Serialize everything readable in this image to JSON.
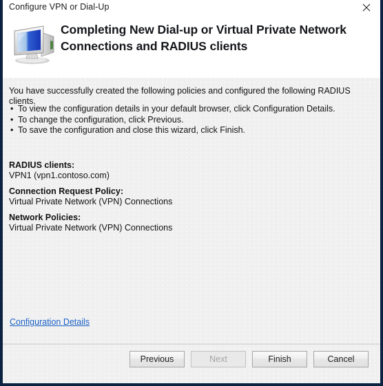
{
  "window": {
    "title": "Configure VPN or Dial-Up",
    "close_icon": "close-icon"
  },
  "header": {
    "icon": "computer-monitor-icon",
    "title": "Completing New Dial-up or Virtual Private Network Connections and RADIUS clients"
  },
  "body": {
    "intro": "You have successfully created the following policies and configured the following RADIUS clients.",
    "bullets": [
      "To view the configuration details in your default browser, click Configuration Details.",
      "To change the configuration, click Previous.",
      "To save the configuration and close this wizard, click Finish."
    ],
    "bullet_glyph": "•",
    "results": [
      {
        "label": "RADIUS clients:",
        "value": "VPN1 (vpn1.contoso.com)"
      },
      {
        "label": "Connection Request Policy:",
        "value": "Virtual Private Network (VPN) Connections"
      },
      {
        "label": "Network Policies:",
        "value": "Virtual Private Network (VPN) Connections"
      }
    ],
    "config_link": "Configuration Details"
  },
  "footer": {
    "buttons": [
      {
        "label": "Previous",
        "disabled": false
      },
      {
        "label": "Next",
        "disabled": true
      },
      {
        "label": "Finish",
        "disabled": false
      },
      {
        "label": "Cancel",
        "disabled": false
      }
    ]
  },
  "colors": {
    "window_border": "#0b2340",
    "header_background": "#ffffff",
    "body_background": "#f0f0f0",
    "link": "#1a61c7",
    "text": "#111111"
  }
}
